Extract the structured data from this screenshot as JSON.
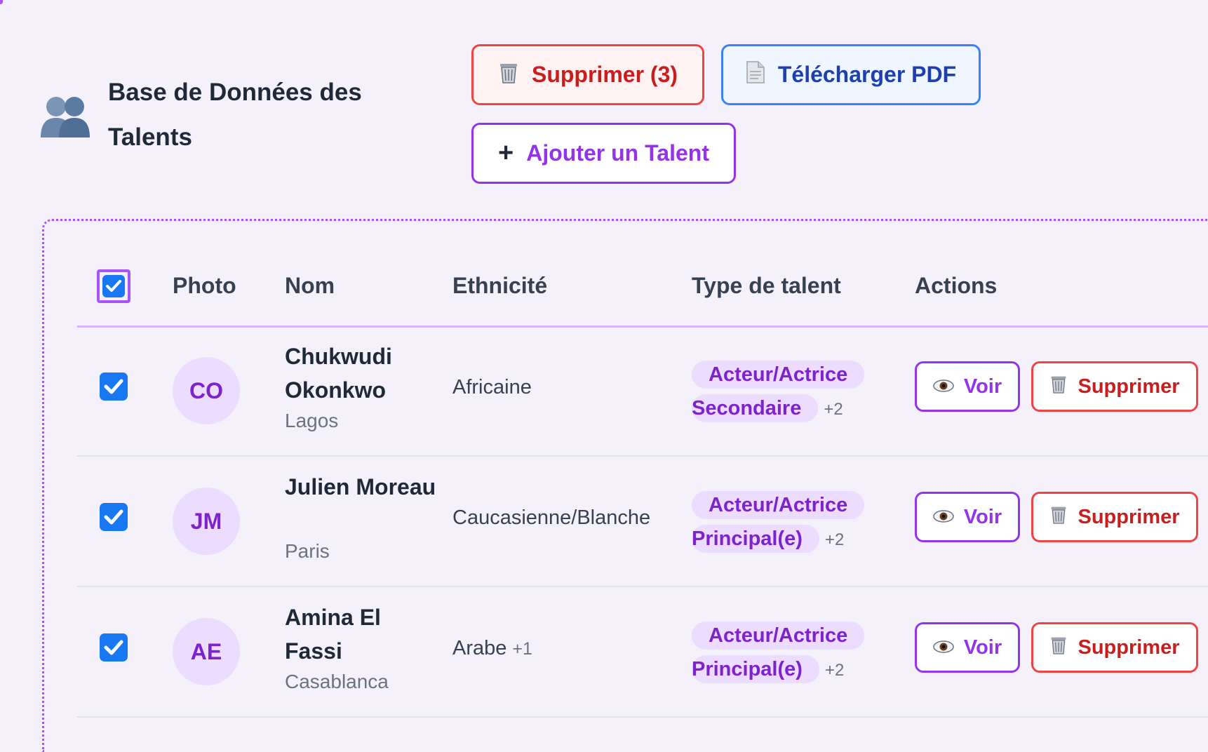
{
  "header": {
    "title": "Base de Données des Talents",
    "icon": "people-silhouette-icon"
  },
  "toolbar": {
    "delete_selected_label": "Supprimer (3)",
    "download_pdf_label": "Télécharger PDF",
    "add_talent_label": "Ajouter un Talent",
    "add_icon_glyph": "+"
  },
  "table": {
    "columns": {
      "photo": "Photo",
      "name": "Nom",
      "ethnicity": "Ethnicité",
      "talent_type": "Type de talent",
      "actions": "Actions"
    },
    "select_all_checked": true,
    "rows": [
      {
        "checked": true,
        "initials": "CO",
        "name": "Chukwudi Okonkwo",
        "city": "Lagos",
        "ethnicity": "Africaine",
        "ethnicity_more": "",
        "talent_line1": "Acteur/Actrice",
        "talent_line2": "Secondaire",
        "talent_more": "+2",
        "view_label": "Voir",
        "delete_label": "Supprimer"
      },
      {
        "checked": true,
        "initials": "JM",
        "name": "Julien Moreau",
        "city": "Paris",
        "ethnicity": "Caucasienne/Blanche",
        "ethnicity_more": "",
        "talent_line1": "Acteur/Actrice",
        "talent_line2": "Principal(e)",
        "talent_more": "+2",
        "view_label": "Voir",
        "delete_label": "Supprimer"
      },
      {
        "checked": true,
        "initials": "AE",
        "name": "Amina El Fassi",
        "city": "Casablanca",
        "ethnicity": "Arabe",
        "ethnicity_more": "+1",
        "talent_line1": "Acteur/Actrice",
        "talent_line2": "Principal(e)",
        "talent_more": "+2",
        "view_label": "Voir",
        "delete_label": "Supprimer"
      }
    ]
  },
  "colors": {
    "accent_purple": "#9333ea",
    "danger_red": "#ef4444",
    "info_blue": "#3b82f6",
    "checkbox_blue": "#1877f2",
    "background": "#f4f1fb"
  }
}
